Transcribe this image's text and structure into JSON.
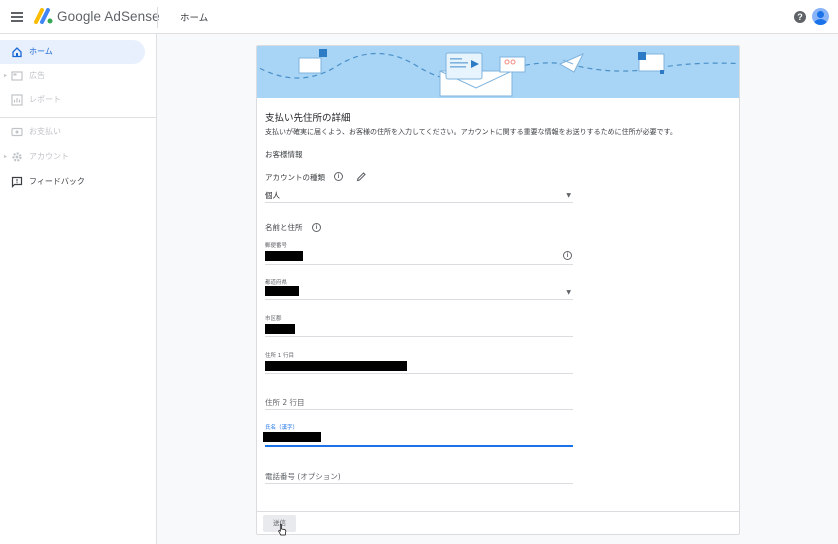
{
  "header": {
    "app_name": "Google AdSense",
    "page_title": "ホーム",
    "help_icon": "?"
  },
  "sidebar": {
    "items": [
      {
        "label": "ホーム",
        "icon": "home-icon",
        "state": "active"
      },
      {
        "label": "広告",
        "icon": "ads-icon",
        "state": "disabled"
      },
      {
        "label": "レポート",
        "icon": "report-icon",
        "state": "disabled"
      },
      {
        "label": "お支払い",
        "icon": "payments-icon",
        "state": "disabled"
      },
      {
        "label": "アカウント",
        "icon": "gear-icon",
        "state": "disabled"
      },
      {
        "label": "フィードバック",
        "icon": "feedback-icon",
        "state": "normal"
      }
    ]
  },
  "form": {
    "title": "支払い先住所の詳細",
    "description": "支払いが確実に届くよう、お客様の住所を入力してください。アカウントに関する重要な情報をお送りするために住所が必要です。",
    "customer_info_label": "お客様情報",
    "account_type_label": "アカウントの種類",
    "account_type_value": "個人",
    "name_address_label": "名前と住所",
    "fields": {
      "postal_code": {
        "label": "郵便番号"
      },
      "prefecture": {
        "label": "都道府県"
      },
      "city": {
        "label": "市区郡"
      },
      "address1": {
        "label": "住所 1 行目"
      },
      "address2": {
        "placeholder": "住所 2 行目"
      },
      "name_kanji": {
        "label": "氏名（漢字）"
      },
      "phone": {
        "placeholder": "電話番号 (オプション)"
      }
    },
    "submit_label": "送信"
  },
  "colors": {
    "accent": "#1a73e8",
    "active_bg": "#e8f0fe",
    "banner_bg": "#a8d4f5"
  }
}
